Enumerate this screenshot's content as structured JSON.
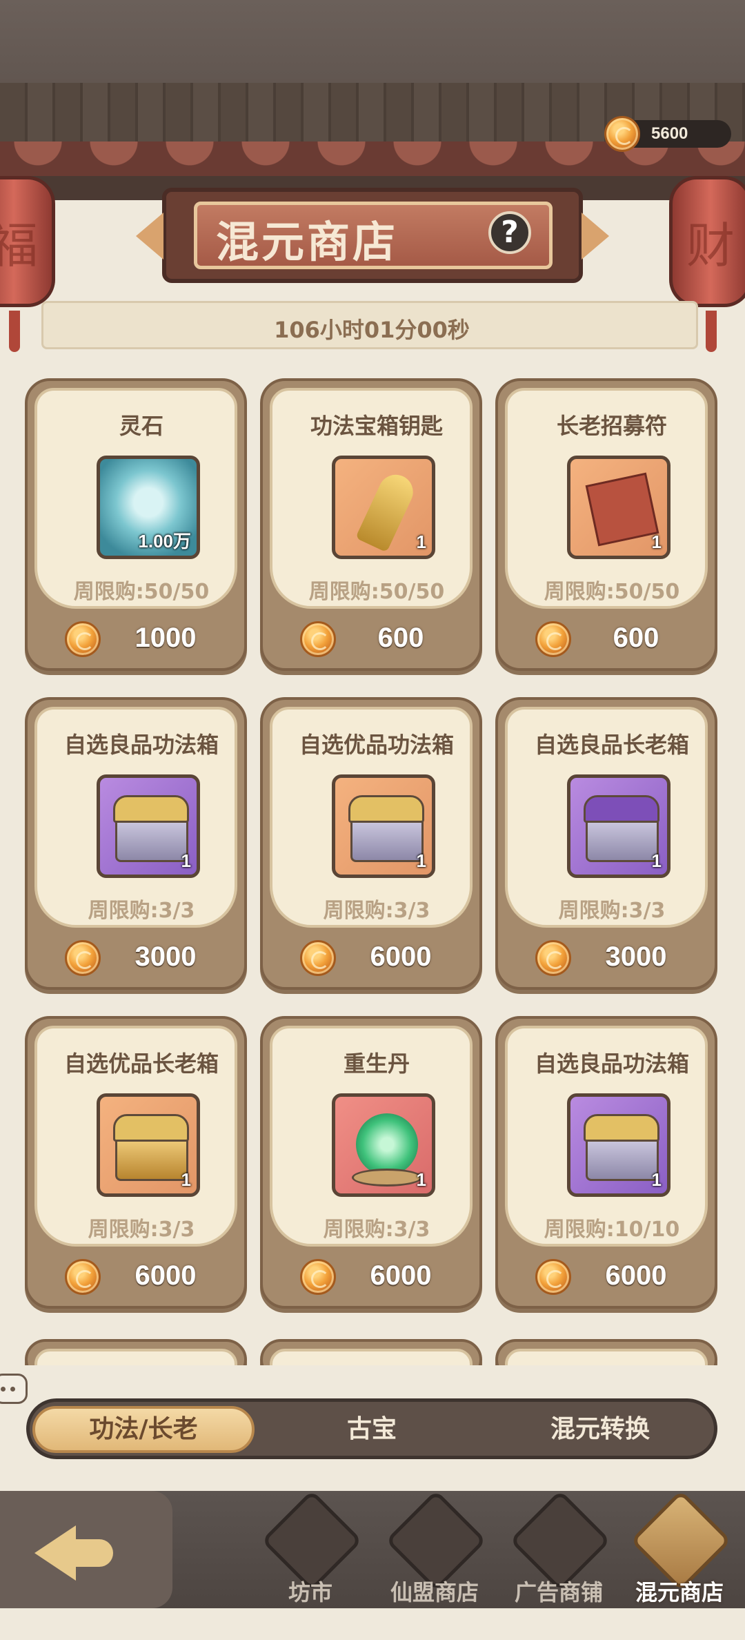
{
  "header": {
    "currency": "5600",
    "title": "混元商店",
    "help": "?",
    "timer": "106小时01分00秒",
    "lantern_left": "福",
    "lantern_right": "财"
  },
  "items": [
    {
      "name": "灵石",
      "qty": "1.00万",
      "limit": "周限购:50/50",
      "price": "1000",
      "icon": "spirit-stone-icon"
    },
    {
      "name": "功法宝箱钥匙",
      "qty": "1",
      "limit": "周限购:50/50",
      "price": "600",
      "icon": "key-icon"
    },
    {
      "name": "长老招募符",
      "qty": "1",
      "limit": "周限购:50/50",
      "price": "600",
      "icon": "talisman-icon"
    },
    {
      "name": "自选良品功法箱",
      "qty": "1",
      "limit": "周限购:3/3",
      "price": "3000",
      "icon": "chest-icon"
    },
    {
      "name": "自选优品功法箱",
      "qty": "1",
      "limit": "周限购:3/3",
      "price": "6000",
      "icon": "chest-icon"
    },
    {
      "name": "自选良品长老箱",
      "qty": "1",
      "limit": "周限购:3/3",
      "price": "3000",
      "icon": "chest-icon"
    },
    {
      "name": "自选优品长老箱",
      "qty": "1",
      "limit": "周限购:3/3",
      "price": "6000",
      "icon": "chest-icon"
    },
    {
      "name": "重生丹",
      "qty": "1",
      "limit": "周限购:3/3",
      "price": "6000",
      "icon": "rebirth-pill-icon"
    },
    {
      "name": "自选良品功法箱",
      "qty": "1",
      "limit": "周限购:10/10",
      "price": "6000",
      "icon": "chest-icon"
    }
  ],
  "tabs": [
    {
      "label": "功法/长老",
      "active": true
    },
    {
      "label": "古宝",
      "active": false
    },
    {
      "label": "混元转换",
      "active": false
    }
  ],
  "bottom_nav": [
    {
      "label": "坊市",
      "active": false
    },
    {
      "label": "仙盟商店",
      "active": false
    },
    {
      "label": "广告商铺",
      "active": false
    },
    {
      "label": "混元商店",
      "active": true
    }
  ],
  "colors": {
    "accent_gold": "#e1b878",
    "card_bg": "#f5ecd6",
    "coin": "#f2a13a"
  }
}
